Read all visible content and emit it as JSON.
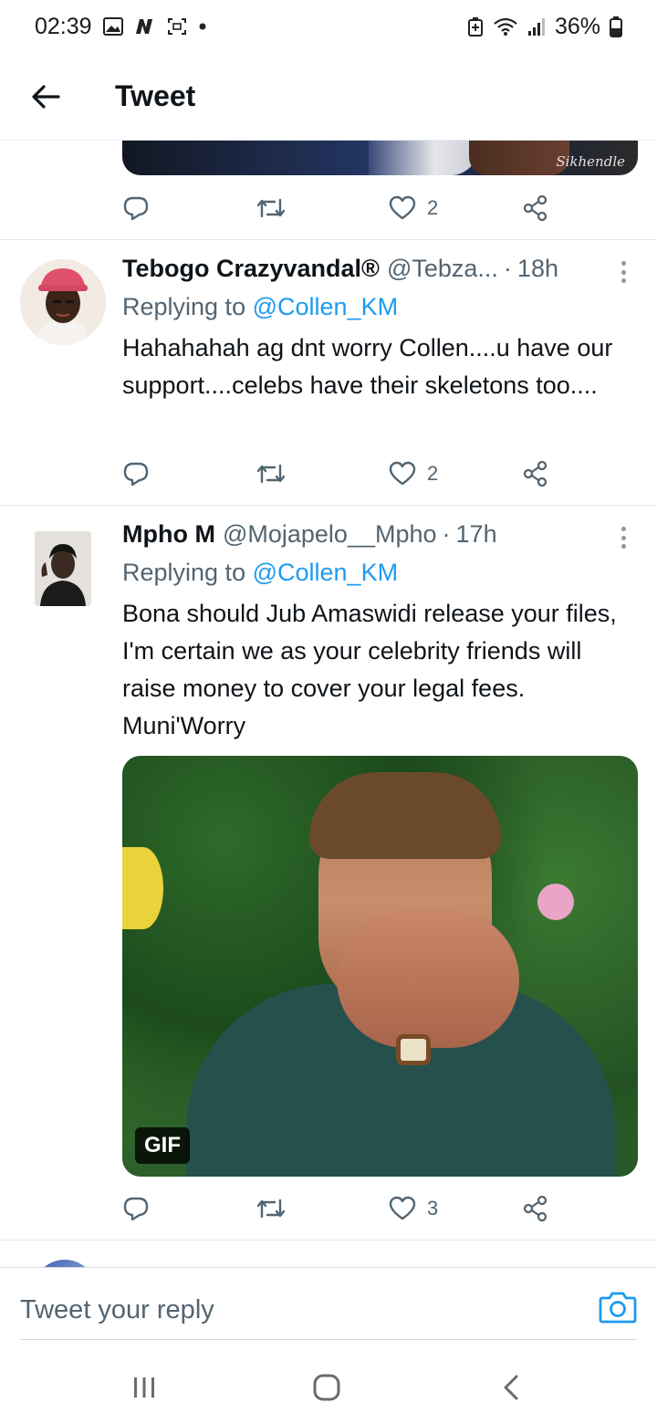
{
  "status_bar": {
    "time": "02:39",
    "battery": "36%"
  },
  "header": {
    "title": "Tweet"
  },
  "top_tweet": {
    "media_watermark": "Sikhendle",
    "likes": "2"
  },
  "tweets": [
    {
      "author": "Tebogo Crazyvandal®",
      "handle": "@Tebza...",
      "separator": "·",
      "time": "18h",
      "replying_prefix": "Replying to",
      "replying_to": "@Collen_KM",
      "text": "Hahahahah ag dnt worry Collen....u have our support....celebs have their skeletons too....",
      "likes": "2"
    },
    {
      "author": "Mpho M",
      "handle": "@Mojapelo__Mpho",
      "separator": "·",
      "time": "17h",
      "replying_prefix": "Replying to",
      "replying_to": "@Collen_KM",
      "text": "Bona should Jub Amaswidi release your files, I'm certain we as your celebrity friends will raise money to cover your legal fees. Muni'Worry",
      "media_badge": "GIF",
      "likes": "3"
    }
  ],
  "composer": {
    "placeholder": "Tweet your reply"
  },
  "colors": {
    "link": "#1d9bf0",
    "text": "#0f1419",
    "secondary": "#536471"
  }
}
